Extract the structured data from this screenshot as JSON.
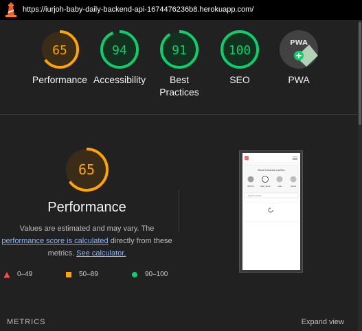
{
  "topbar": {
    "url": "https://iurjoh-baby-daily-backend-api-1674476236b8.herokuapp.com/"
  },
  "gauges": [
    {
      "label": "Performance",
      "score": "65",
      "value": 0.65,
      "color": "#ffa400"
    },
    {
      "label": "Accessibility",
      "score": "94",
      "value": 0.94,
      "color": "#0cce6b"
    },
    {
      "label": "Best Practices",
      "score": "91",
      "value": 0.91,
      "color": "#0cce6b"
    },
    {
      "label": "SEO",
      "score": "100",
      "value": 1.0,
      "color": "#0cce6b"
    },
    {
      "label": "PWA",
      "icon": "pwa-icon"
    }
  ],
  "performance": {
    "score": "65",
    "value": 0.65,
    "title": "Performance",
    "desc_prefix": "Values are estimated and may vary. The",
    "link1": "performance score is calculated",
    "desc_middle": "directly from these metrics.",
    "link2": "See calculator."
  },
  "legend": [
    {
      "range": "0–49",
      "icon": "fail-triangle-icon",
      "color": "#ff4e42"
    },
    {
      "range": "50–89",
      "icon": "average-square-icon",
      "color": "#ffa400"
    },
    {
      "range": "90–100",
      "icon": "pass-circle-icon",
      "color": "#0cce6b"
    }
  ],
  "screenshot": {
    "header_title": "Most followed profiles",
    "profiles": [
      "admin",
      "new_alice",
      "new",
      "name"
    ],
    "search_placeholder": "Search posts"
  },
  "footer": {
    "metrics_label": "METRICS",
    "expand_label": "Expand view"
  }
}
